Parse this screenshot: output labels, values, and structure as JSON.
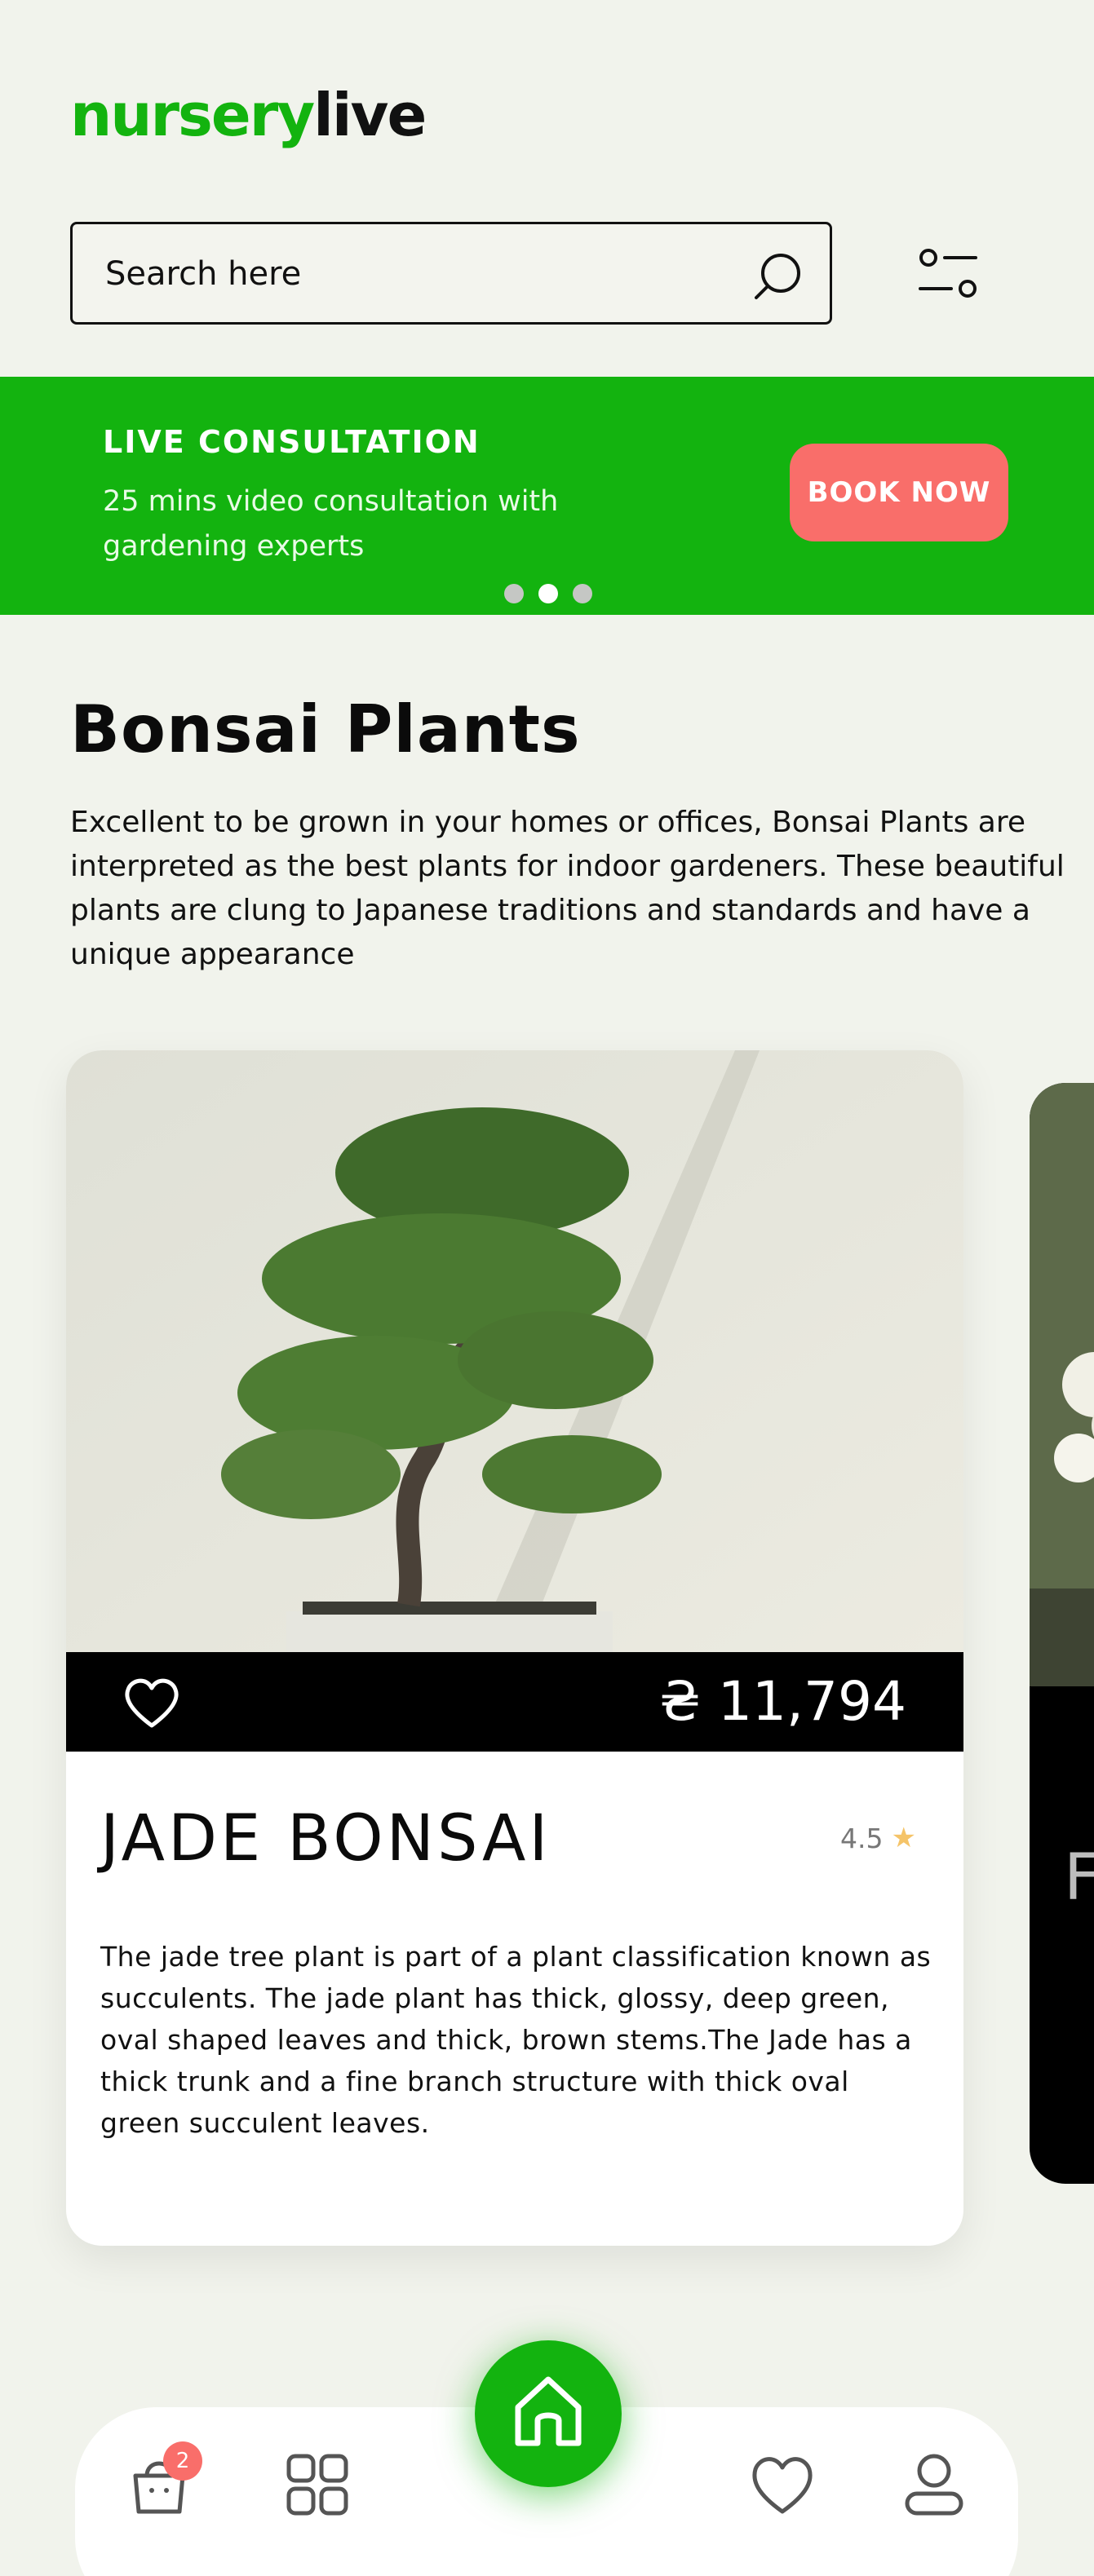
{
  "brand": {
    "logo_part1": "nursery",
    "logo_part2": "live",
    "accent": "#13b30f"
  },
  "search": {
    "placeholder": "Search here",
    "icon": "search-icon"
  },
  "filter": {
    "icon": "filter-icon"
  },
  "banner": {
    "title": "LIVE CONSULTATION",
    "text": "25 mins video consultation with gardening experts",
    "cta": "BOOK NOW",
    "cta_color": "#f96e6a",
    "slides_total": 3,
    "active_slide": 2
  },
  "section": {
    "title": "Bonsai Plants",
    "description": "Excellent to be grown in your homes or offices, Bonsai Plants are interpreted as the best plants for indoor gardeners. These beautiful plants are clung to Japanese traditions and standards and have a unique appearance"
  },
  "product": {
    "price": "₴ 11,794",
    "name": "JADE BONSAI",
    "rating": "4.5",
    "description": "The jade tree plant is part of a plant classification known as succulents. The jade plant has thick, glossy, deep green, oval shaped leaves and thick, brown stems.The Jade has a thick trunk and a fine branch structure with thick oval green succulent leaves."
  },
  "next_product": {
    "name_initial": "F"
  },
  "nav": {
    "cart_badge": "2",
    "items": [
      "cart-icon",
      "grid-icon",
      "home-icon",
      "heart-icon",
      "profile-icon"
    ]
  }
}
